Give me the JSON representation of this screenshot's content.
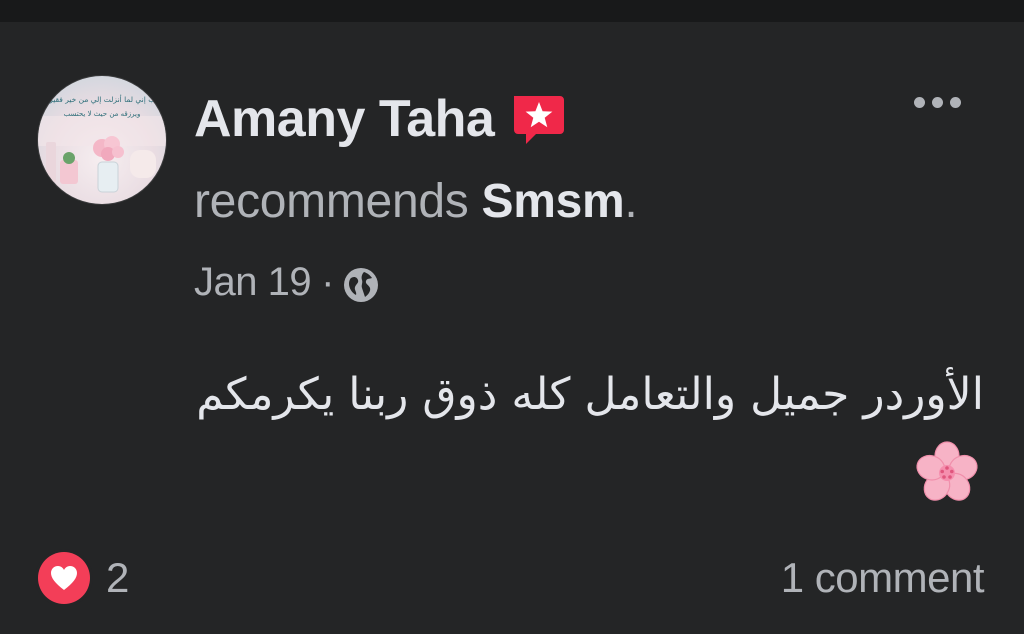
{
  "post": {
    "author_name": "Amany Taha",
    "avatar_text_line1": "رب إني لما أنزلت إلي من خير فقير",
    "avatar_text_line2": "ويرزقه من حيث لا يحتسب",
    "recommend_verb": "recommends",
    "recommended_page": "Smsm",
    "recommend_suffix": ".",
    "date": "Jan 19",
    "date_separator": "·",
    "privacy_icon": "globe-icon",
    "badge_icon": "star-recommendation-icon",
    "body_text": "الأوردر جميل والتعامل كله ذوق ربنا يكرمكم",
    "body_emoji_icon": "cherry-blossom-icon"
  },
  "footer": {
    "reaction_icon": "heart-reaction-icon",
    "reaction_count": "2",
    "comments_label": "1 comment"
  },
  "colors": {
    "background": "#242526",
    "top_strip": "#18191a",
    "primary_text": "#e4e6eb",
    "secondary_text": "#b0b3b8",
    "badge_red": "#f02849",
    "love_red": "#f33e58",
    "blossom_pink": "#f7b3c6"
  }
}
